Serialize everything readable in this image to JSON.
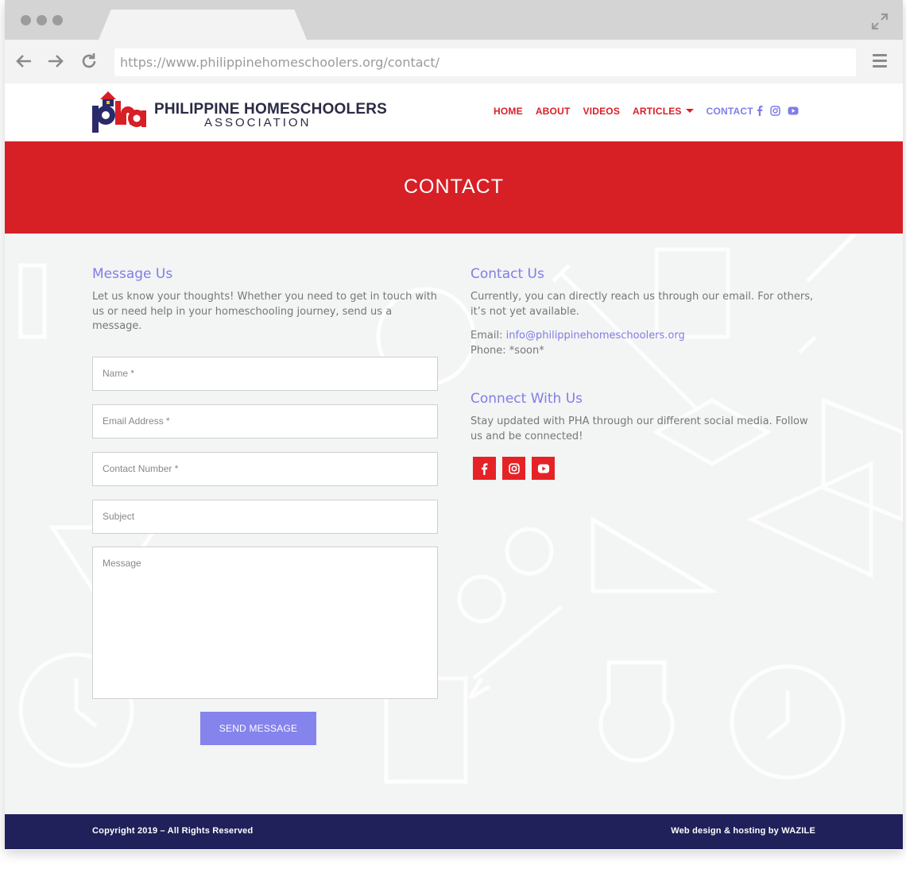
{
  "browser": {
    "url": "https://www.philippinehomeschoolers.org/contact/"
  },
  "header": {
    "logo_text": "pha",
    "brand_line1": "PHILIPPINE HOMESCHOOLERS",
    "brand_line2": "ASSOCIATION",
    "menu": [
      {
        "label": "HOME"
      },
      {
        "label": "ABOUT"
      },
      {
        "label": "VIDEOS"
      },
      {
        "label": "ARTICLES"
      },
      {
        "label": "CONTACT"
      }
    ],
    "social_icons": [
      "facebook-icon",
      "instagram-icon",
      "youtube-icon"
    ]
  },
  "banner": {
    "title": "CONTACT"
  },
  "message_us": {
    "heading": "Message Us",
    "intro_lines": [
      "Let us know your thoughts! Whether you need to get in touch with",
      "us or need help in your homeschooling journey, send us a",
      "message."
    ],
    "fields": {
      "name": "Name *",
      "email": "Email Address *",
      "contact": "Contact Number *",
      "subject": "Subject",
      "message": "Message"
    },
    "send_label": "SEND MESSAGE"
  },
  "contact_us": {
    "heading": "Contact Us",
    "intro_lines": [
      "Currently, you can directly reach us through our email. For others,",
      "it’s not yet available."
    ],
    "email_label": "Email:",
    "email_value": "info@philippinehomeschoolers.org",
    "phone_label": "Phone:",
    "phone_value": "*soon*"
  },
  "connect": {
    "heading": "Connect With Us",
    "intro_lines": [
      "Stay updated with PHA through our different social media. Follow",
      "us and be connected!"
    ]
  },
  "footer": {
    "copyright": "Copyright 2019 – All Rights Reserved",
    "credit": "Web design & hosting by WAZILE"
  },
  "colors": {
    "brand_red": "#d71f26",
    "accent_purple": "#7f7ee8",
    "footer_navy": "#20205a"
  }
}
